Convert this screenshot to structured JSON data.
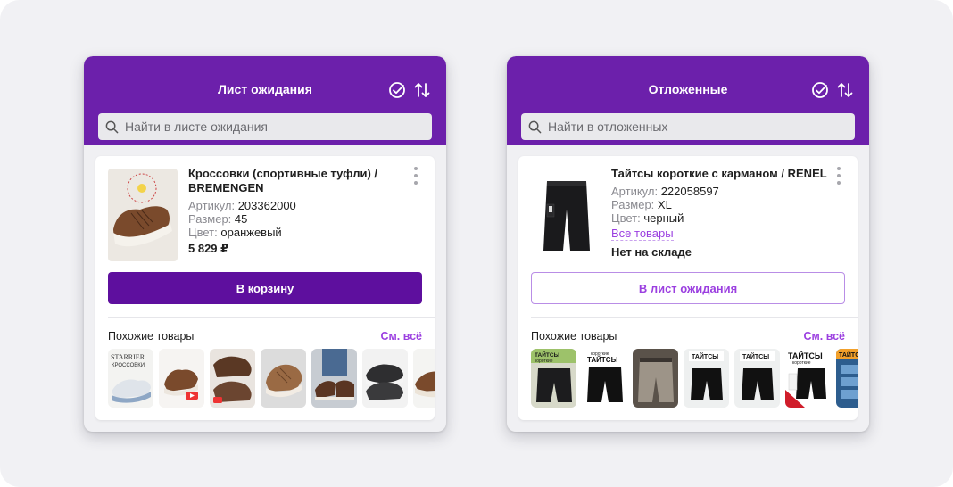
{
  "waitlist": {
    "title": "Лист ожидания",
    "search_placeholder": "Найти в листе ожидания",
    "product": {
      "title": "Кроссовки (спортивные туфли) / BREMENGEN",
      "article_label": "Артикул:",
      "article_value": "203362000",
      "size_label": "Размер:",
      "size_value": "45",
      "color_label": "Цвет:",
      "color_value": "оранжевый",
      "price": "5 829 ₽"
    },
    "button_label": "В корзину",
    "similar_label": "Похожие товары",
    "see_all": "См. всё",
    "thumb_texts": {
      "t1_top": "STARRIER",
      "t1_sub": "КРОССОВКИ"
    }
  },
  "saved": {
    "title": "Отложенные",
    "search_placeholder": "Найти в отложенных",
    "product": {
      "title": "Тайтсы короткие с карманом / RENEL",
      "article_label": "Артикул:",
      "article_value": "222058597",
      "size_label": "Размер:",
      "size_value": "XL",
      "color_label": "Цвет:",
      "color_value": "черный",
      "all_items_link": "Все товары",
      "stock_status": "Нет на складе"
    },
    "button_label": "В лист ожидания",
    "similar_label": "Похожие товары",
    "see_all": "См. всё",
    "thumb_texts": {
      "t1": "ТАЙТСЫ",
      "t1_sub": "короткие",
      "t2_top": "короткие",
      "t2": "ТАЙТСЫ",
      "t4": "ТАЙТСЫ",
      "t5": "ТАЙТСЫ",
      "t6": "ТАЙТСЫ",
      "t6_sub": "короткие",
      "t7": "ТАЙТСЫ"
    }
  },
  "colors": {
    "header": "#6c20ab",
    "primary_button": "#5e0f9e",
    "accent": "#9b3fe0"
  },
  "icons": [
    "check-circle-icon",
    "sort-arrows-icon",
    "search-icon",
    "more-vertical-icon"
  ]
}
